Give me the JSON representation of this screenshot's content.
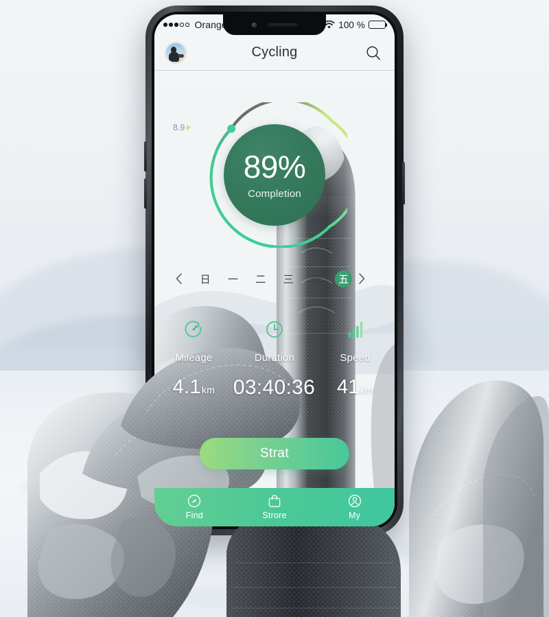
{
  "status_bar": {
    "signal_dots_filled": 3,
    "signal_dots_total": 5,
    "carrier": "Orange F",
    "wifi_icon": "wifi-icon",
    "battery_percent": "100 %",
    "battery_icon": "battery-full-icon"
  },
  "app_bar": {
    "avatar_name": "user-avatar",
    "title": "Cycling",
    "search_icon": "search-icon"
  },
  "progress_ring": {
    "marker_label": "8.9",
    "percent_text": "89%",
    "caption": "Completion",
    "percent_value": 89,
    "track_colors": {
      "start_green": "#3ecf95",
      "mid_gray": "#5b5f63",
      "light_green": "#c8e87f",
      "inner_circle": "#357a5d"
    }
  },
  "day_selector": {
    "prev_icon": "chevron-left-icon",
    "next_icon": "chevron-right-icon",
    "days": [
      {
        "label": "日",
        "active": false
      },
      {
        "label": "一",
        "active": false
      },
      {
        "label": "二",
        "active": false
      },
      {
        "label": "三",
        "active": false
      },
      {
        "label": "四",
        "active": false
      },
      {
        "label": "五",
        "active": true
      }
    ],
    "active_color": "#3b9e71"
  },
  "stats": [
    {
      "icon": "speedometer-icon",
      "label": "Mileage",
      "value": "4.1",
      "unit": "km"
    },
    {
      "icon": "clock-icon",
      "label": "Duration",
      "value": "03:40:36",
      "unit": ""
    },
    {
      "icon": "bar-chart-icon",
      "label": "Speed",
      "value": "41",
      "unit": "km"
    }
  ],
  "start_button": {
    "label": "Strat",
    "gradient_from": "#9ddb7e",
    "gradient_to": "#47c79b"
  },
  "tab_bar": {
    "tabs": [
      {
        "icon": "search-circle-icon",
        "label": "Find"
      },
      {
        "icon": "shopping-bag-icon",
        "label": "Strore"
      },
      {
        "icon": "person-icon",
        "label": "My"
      }
    ],
    "background_from": "#63cf93",
    "background_to": "#3fc79f"
  }
}
